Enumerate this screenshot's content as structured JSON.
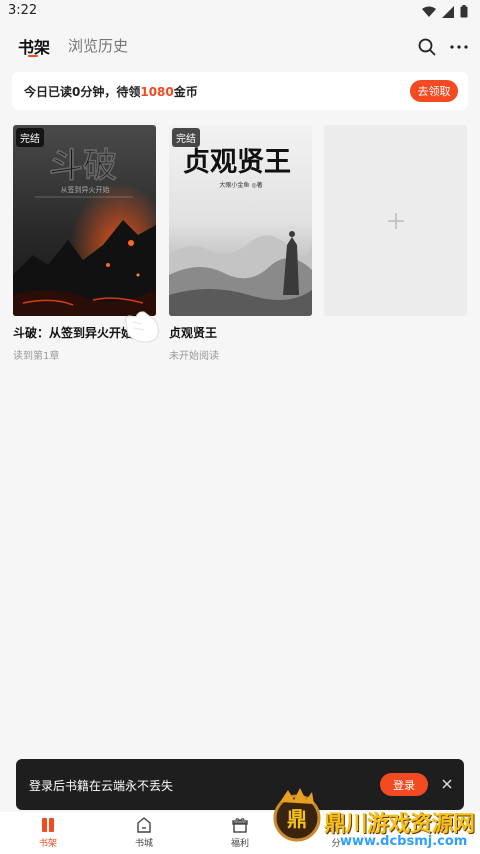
{
  "status_bar": {
    "time": "3:22"
  },
  "header": {
    "tabs": [
      {
        "label": "书架",
        "active": true
      },
      {
        "label": "浏览历史",
        "active": false
      }
    ]
  },
  "banner": {
    "text_prefix": "今日已读0分钟，待领",
    "coins": "1080",
    "text_suffix": "金币",
    "button_label": "去领取"
  },
  "books": [
    {
      "title": "斗破：从签到异火开始",
      "progress": "读到第1章",
      "status_tag": "完结",
      "cover_title": "斗破",
      "cover_subtitle": "从签到异火开始"
    },
    {
      "title": "贞观贤王",
      "progress": "未开始阅读",
      "status_tag": "完结",
      "cover_title": "贞观贤王",
      "cover_subtitle": "大眼小金鱼 ◎著"
    }
  ],
  "login_prompt": {
    "text": "登录后书籍在云端永不丢失",
    "button_label": "登录"
  },
  "bottom_nav": {
    "items": [
      {
        "label": "书架",
        "icon": "bookshelf-icon",
        "active": true
      },
      {
        "label": "书城",
        "icon": "bookstore-icon",
        "active": false
      },
      {
        "label": "福利",
        "icon": "gift-icon",
        "active": false
      },
      {
        "label": "分",
        "icon": "category-icon",
        "active": false
      }
    ]
  },
  "watermark": {
    "text": "鼎川游戏资源网",
    "url": "www.dcbsmj.com",
    "logo_text": "鼎"
  },
  "colors": {
    "accent": "#f44a22",
    "background": "#f6f6f6"
  }
}
